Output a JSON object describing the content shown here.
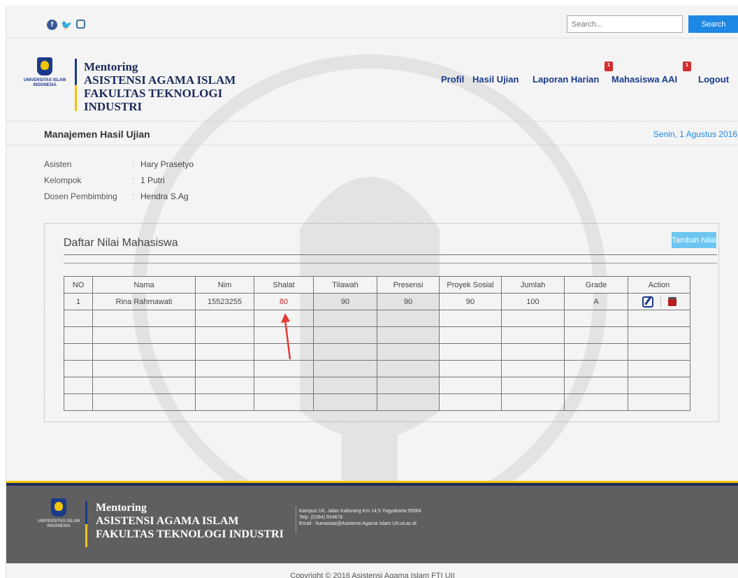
{
  "topbar": {
    "social": [
      "facebook-icon",
      "twitter-icon",
      "instagram-icon"
    ],
    "search_placeholder": "Search...",
    "search_label": "Search"
  },
  "header": {
    "logo_text": "UNIVERSITAS ISLAM INDONESIA",
    "brand_line1": "Mentoring",
    "brand_line2": "ASISTENSI AGAMA ISLAM",
    "brand_line3": "FAKULTAS TEKNOLOGI",
    "brand_line4": "INDUSTRI",
    "nav": [
      {
        "label": "Profil"
      },
      {
        "label": "Hasil Ujian"
      },
      {
        "label": "Laporan Harian",
        "badge": "1"
      },
      {
        "label": "Mahasiswa AAI",
        "badge": "1"
      },
      {
        "label": "Logout"
      }
    ]
  },
  "titlebar": {
    "title": "Manajemen Hasil Ujian",
    "date": "Senin, 1 Agustus 2016"
  },
  "info": [
    {
      "label": "Asisten",
      "value": "Hary Prasetyo"
    },
    {
      "label": "Kelompok",
      "value": "1 Putri"
    },
    {
      "label": "Dosen Pembimbing",
      "value": "Hendra S.Ag"
    }
  ],
  "panel": {
    "title": "Daftar Nilai Mahasiswa",
    "add_label": "Tambah Nilai",
    "columns": [
      "NO",
      "Nama",
      "Nim",
      "Shalat",
      "Tilawah",
      "Presensi",
      "Proyek Sosial",
      "Jumlah",
      "Grade",
      "Action"
    ],
    "rows": [
      [
        "1",
        "Rina Rahmawati",
        "15523255",
        "80",
        "90",
        "90",
        "90",
        "100",
        "A"
      ]
    ],
    "empty_rows": 6
  },
  "footer": {
    "brand_line1": "Mentoring",
    "brand_line2": "ASISTENSI AGAMA ISLAM",
    "brand_line3": "FAKULTAS TEKNOLOGI INDUSTRI",
    "logo_text": "UNIVERSITAS ISLAM INDONESIA",
    "address": "Kampus UII, Jalan Kaliurang Km 14,5 Yogyakarta 55584",
    "phone": "Telp. (0284) 554678",
    "email": "Email : humasaai@Asistensi Agama Islam UII.uii.ac.id",
    "copyright": "Copyright © 2016 Asistensi Agama Islam FTI UII"
  },
  "colors": {
    "accent": "#1e88e5",
    "brand_navy": "#1a3a8a",
    "brand_gold": "#f2c500",
    "highlight_red": "#c62828",
    "footer_bg": "#5f5f5f"
  }
}
